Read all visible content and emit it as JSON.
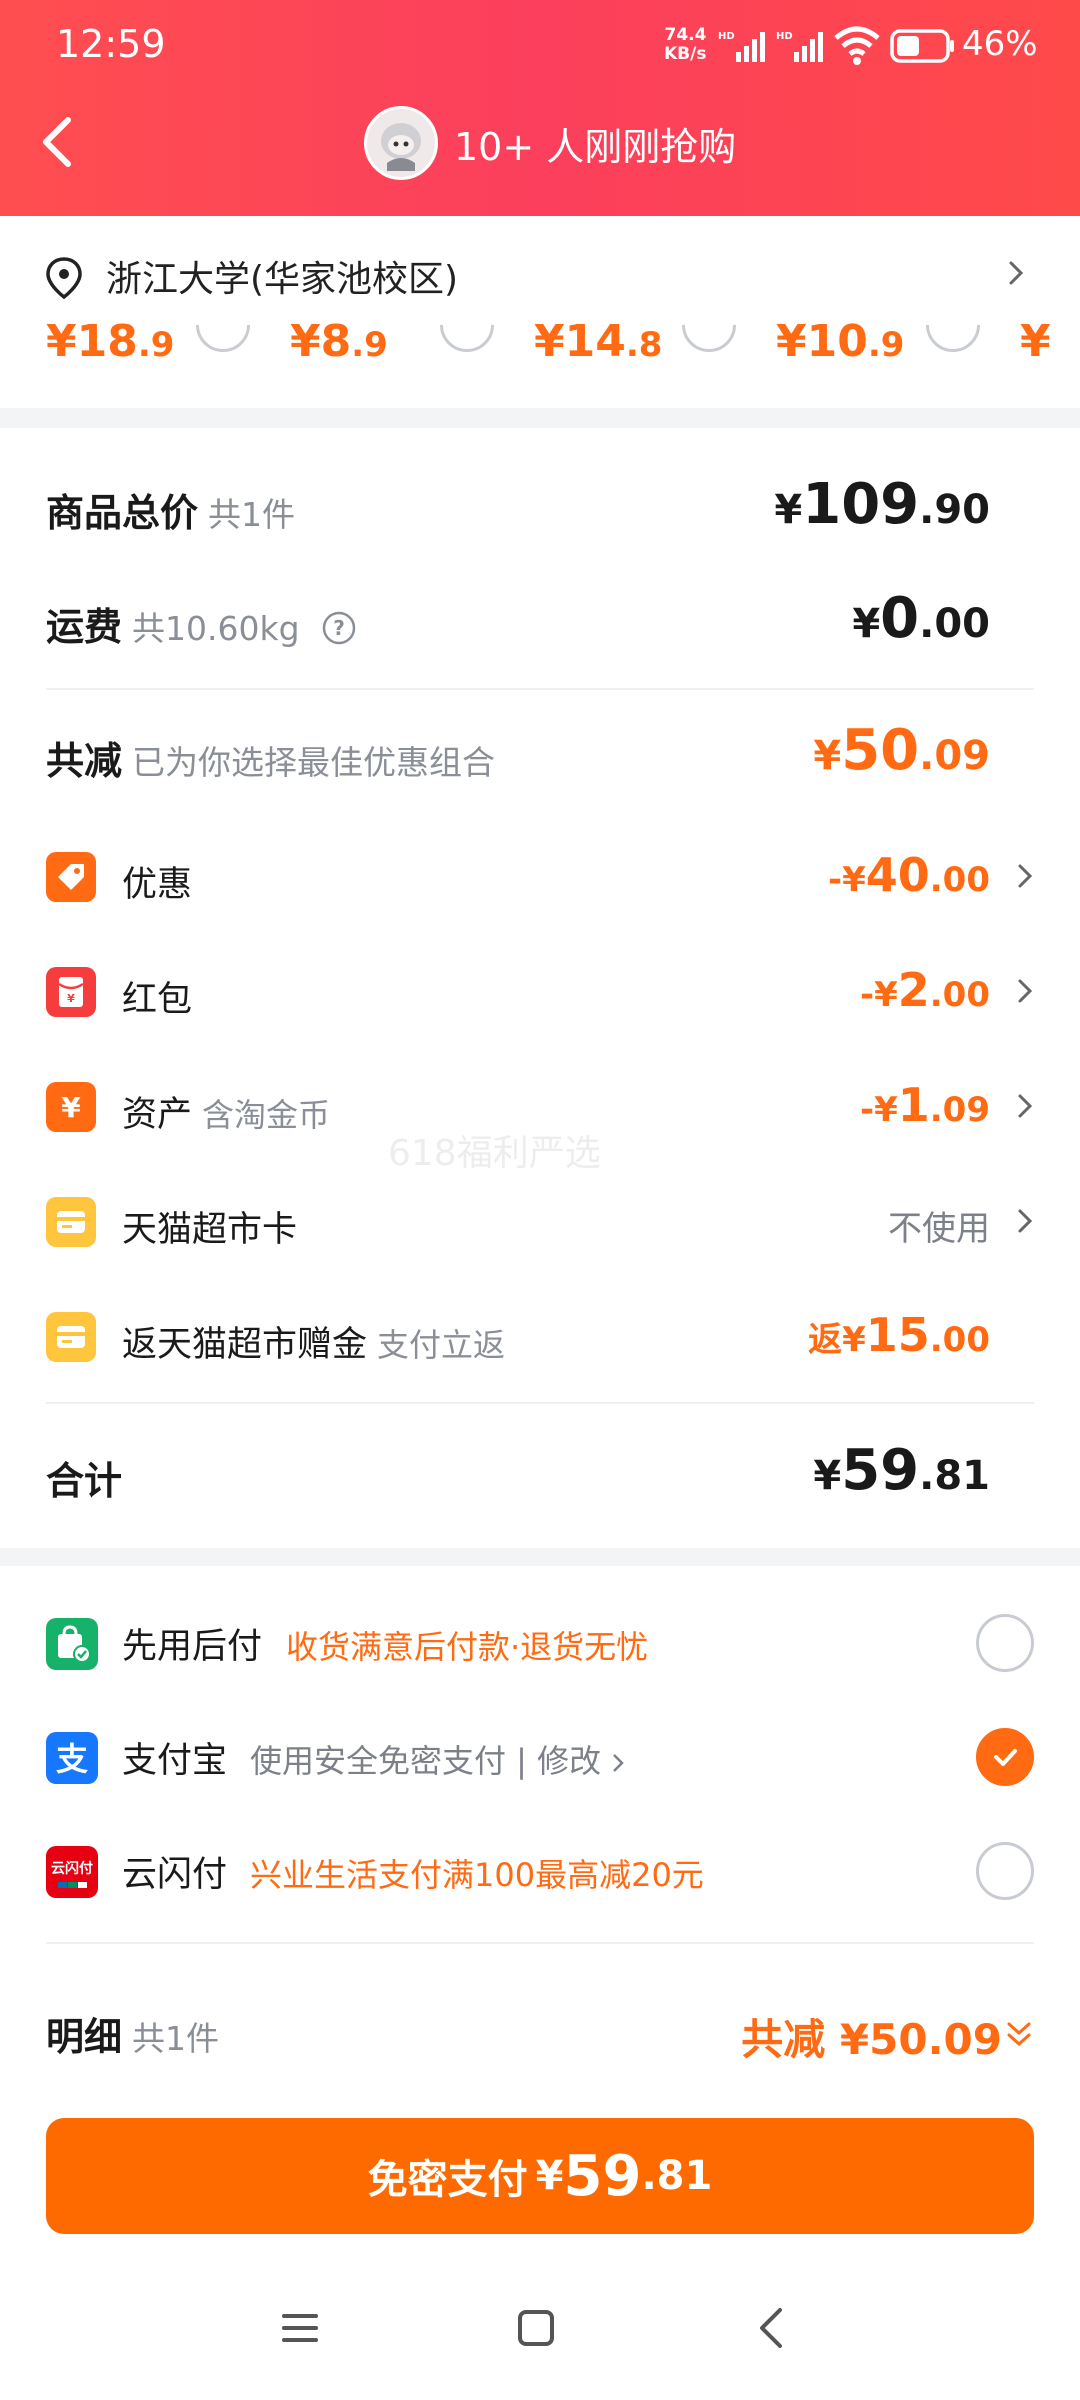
{
  "status_bar": {
    "time": "12:59",
    "net_speed_top": "74.4",
    "net_speed_bottom": "KB/s",
    "hd1": "HD",
    "hd2": "HD",
    "battery": "46%"
  },
  "header": {
    "title": "10+ 人刚刚抢购"
  },
  "address": {
    "text": "浙江大学(华家池校区)",
    "prices": [
      {
        "yen": "¥",
        "int": "18",
        "dec": ".9"
      },
      {
        "yen": "¥",
        "int": "8",
        "dec": ".9"
      },
      {
        "yen": "¥",
        "int": "14",
        "dec": ".8"
      },
      {
        "yen": "¥",
        "int": "10",
        "dec": ".9"
      },
      {
        "yen": "¥",
        "int": "",
        "dec": ""
      }
    ]
  },
  "summary": {
    "goods_total": {
      "label": "商品总价",
      "sub": "共1件",
      "yen": "¥",
      "int": "109",
      "dec": ".90"
    },
    "shipping": {
      "label": "运费",
      "sub": "共10.60kg",
      "yen": "¥",
      "int": "0",
      "dec": ".00"
    },
    "discount": {
      "label": "共减",
      "sub": "已为你选择最佳优惠组合",
      "yen": "¥",
      "int": "50",
      "dec": ".09"
    },
    "items": [
      {
        "label": "优惠",
        "sub": "",
        "prefix": "-¥",
        "int": "40",
        "dec": ".00",
        "icon": "coupon-tag-icon"
      },
      {
        "label": "红包",
        "sub": "",
        "prefix": "-¥",
        "int": "2",
        "dec": ".00",
        "icon": "red-envelope-icon"
      },
      {
        "label": "资产",
        "sub": "含淘金币",
        "prefix": "-¥",
        "int": "1",
        "dec": ".09",
        "icon": "yuan-coin-icon"
      },
      {
        "label": "天猫超市卡",
        "sub": "",
        "value": "不使用",
        "icon": "card-icon"
      },
      {
        "label": "返天猫超市赠金",
        "sub": "支付立返",
        "prefix": "返¥",
        "int": "15",
        "dec": ".00",
        "icon": "card-icon"
      }
    ],
    "total": {
      "label": "合计",
      "yen": "¥",
      "int": "59",
      "dec": ".81"
    },
    "watermark": "618福利严选"
  },
  "payment": {
    "methods": [
      {
        "name": "先用后付",
        "desc": "收货满意后付款·退货无忧",
        "selected": false
      },
      {
        "name": "支付宝",
        "desc": "使用安全免密支付 | 修改 ",
        "selected": true
      },
      {
        "name": "云闪付",
        "desc": "兴业生活支付满100最高减20元",
        "selected": false
      }
    ],
    "detail": {
      "label": "明细",
      "sub": "共1件",
      "right": "共减 ¥50.09"
    },
    "button": {
      "text": "免密支付",
      "yen": "¥",
      "int": "59",
      "dec": ".81"
    }
  },
  "colors": {
    "header_red": "#fb3f5c",
    "accent_orange": "#ff6a13",
    "button_orange": "#ff6a00"
  }
}
